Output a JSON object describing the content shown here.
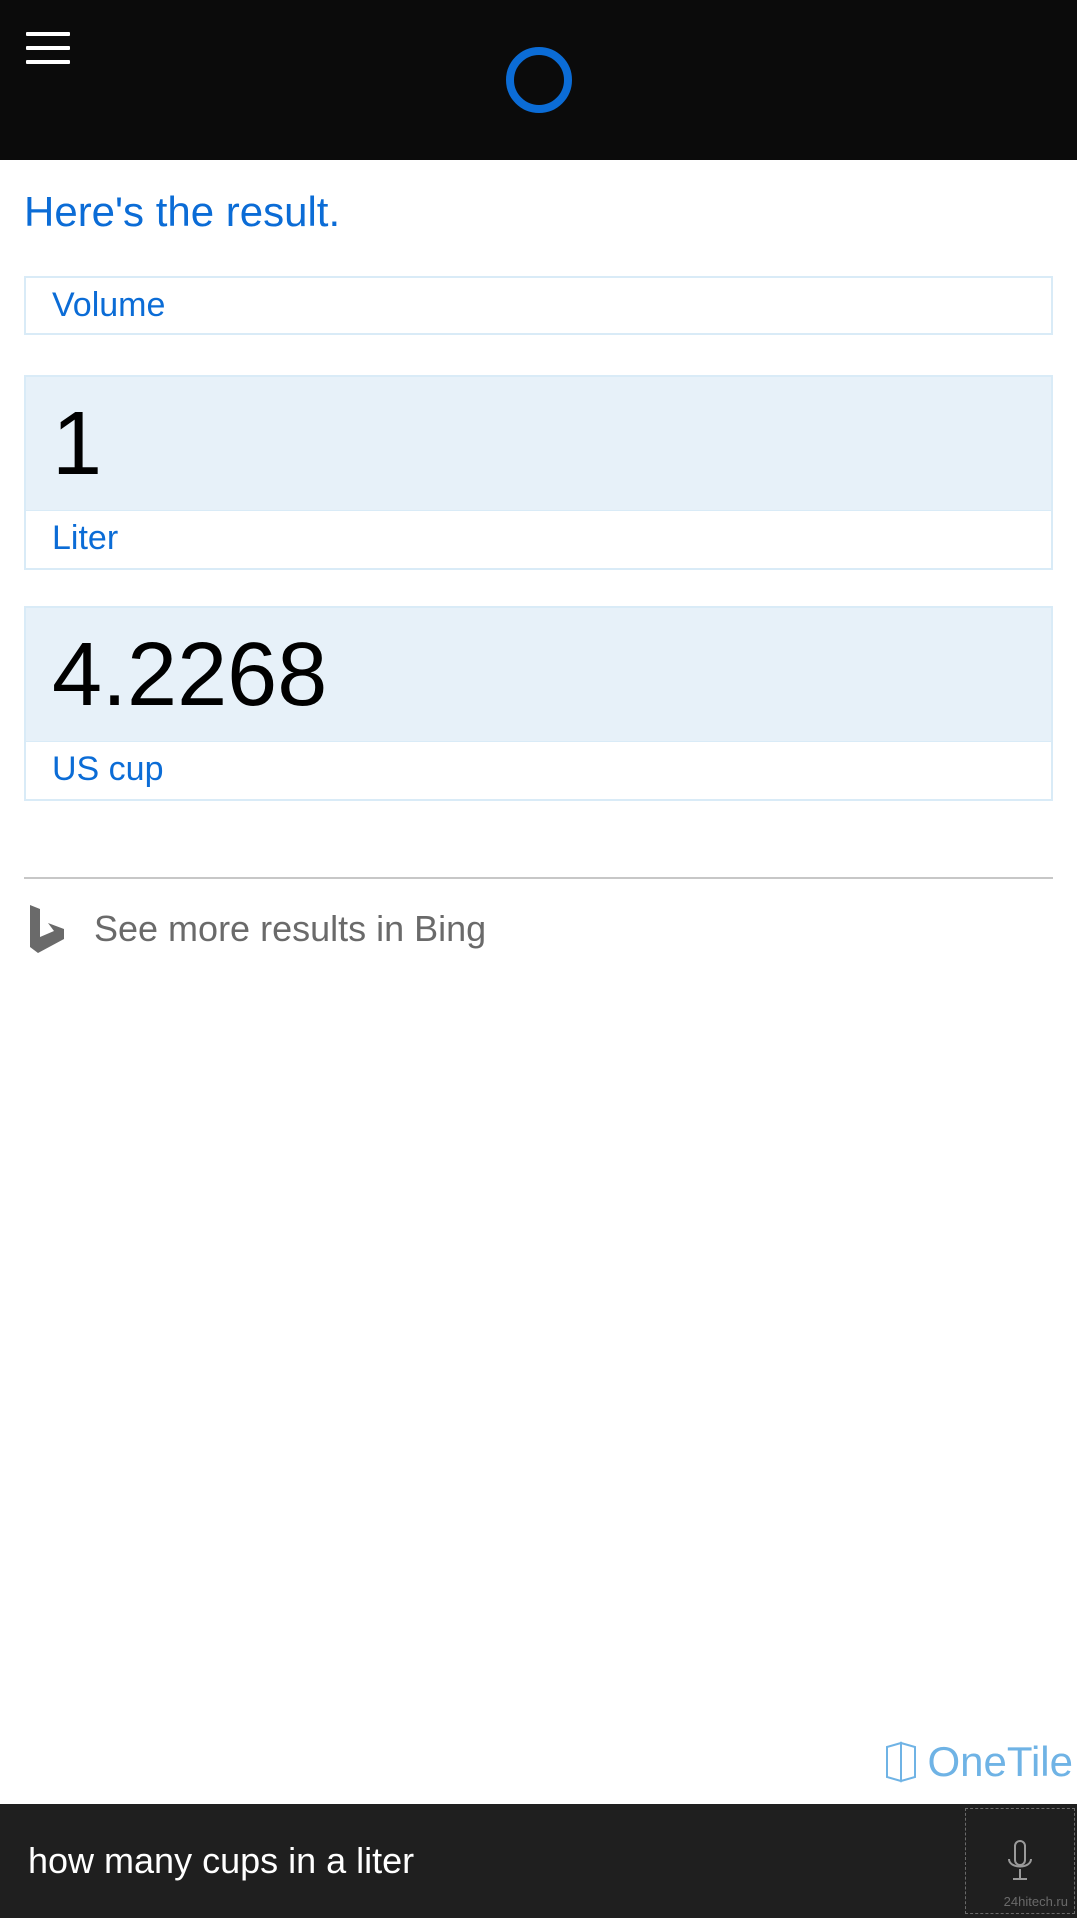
{
  "colors": {
    "accent": "#0b6cd6",
    "header_bg": "#0b0b0b",
    "panel_bg": "#e7f1f9",
    "panel_border": "#d9ebf7",
    "footer_bg": "#1f1f1f",
    "muted": "#6a6a6a"
  },
  "header": {
    "menu_icon": "hamburger",
    "assistant_icon": "cortana-ring"
  },
  "result": {
    "title": "Here's the result.",
    "category": "Volume",
    "from": {
      "value": "1",
      "unit": "Liter"
    },
    "to": {
      "value": "4.2268",
      "unit": "US cup"
    }
  },
  "bing": {
    "label": "See more results in Bing",
    "icon": "bing-logo"
  },
  "badge": {
    "label": "OneTile",
    "icon": "onetile-icon"
  },
  "search": {
    "query": "how many cups in a liter",
    "mic_icon": "microphone-icon",
    "watermark": "24hitech.ru"
  }
}
